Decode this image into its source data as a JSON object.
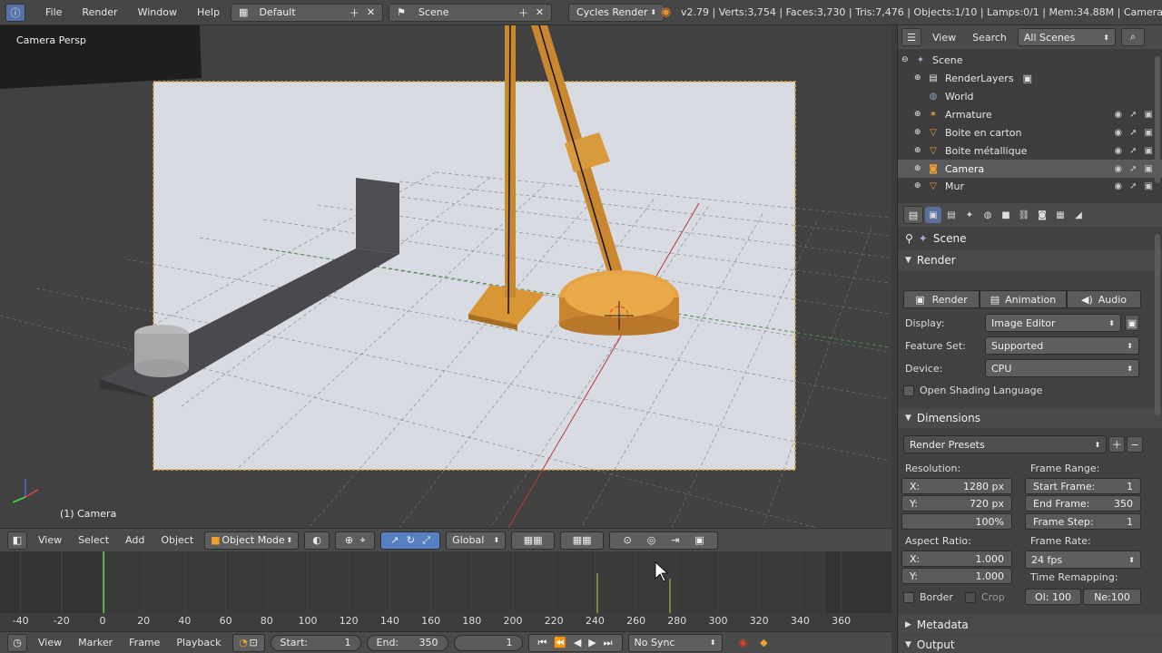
{
  "topbar": {
    "menu": [
      "File",
      "Render",
      "Window",
      "Help"
    ],
    "layout": "Default",
    "scene": "Scene",
    "engine": "Cycles Render",
    "stats": "v2.79 | Verts:3,754 | Faces:3,730 | Tris:7,476 | Objects:1/10 | Lamps:0/1 | Mem:34.88M | Camera"
  },
  "viewport": {
    "label": "Camera Persp",
    "object": "(1) Camera"
  },
  "vp_header": {
    "menu": [
      "View",
      "Select",
      "Add",
      "Object"
    ],
    "mode": "Object Mode",
    "orientation": "Global"
  },
  "timeline": {
    "ticks": [
      -40,
      -20,
      0,
      20,
      40,
      60,
      80,
      100,
      120,
      140,
      160,
      180,
      200,
      220,
      240,
      260,
      280,
      300,
      320,
      340,
      360
    ],
    "current_frame_marker": 1
  },
  "tl_header": {
    "menu": [
      "View",
      "Marker",
      "Frame",
      "Playback"
    ],
    "start_label": "Start:",
    "start_value": "1",
    "end_label": "End:",
    "end_value": "350",
    "current": "1",
    "sync": "No Sync"
  },
  "outliner": {
    "view": "View",
    "search": "Search",
    "filter": "All Scenes",
    "items": [
      "Scene",
      "RenderLayers",
      "World",
      "Armature",
      "Boite en carton",
      "Boite métallique",
      "Camera",
      "Mur"
    ]
  },
  "properties": {
    "context": "Scene",
    "render_title": "Render",
    "render_btn": "Render",
    "animation_btn": "Animation",
    "audio_btn": "Audio",
    "display_label": "Display:",
    "display_value": "Image Editor",
    "feature_label": "Feature Set:",
    "feature_value": "Supported",
    "device_label": "Device:",
    "device_value": "CPU",
    "osl": "Open Shading Language",
    "dimensions_title": "Dimensions",
    "presets": "Render Presets",
    "resolution_label": "Resolution:",
    "res_x_label": "X:",
    "res_x": "1280 px",
    "res_y_label": "Y:",
    "res_y": "720 px",
    "res_pct": "100%",
    "frame_range_label": "Frame Range:",
    "start_frame_label": "Start Frame:",
    "start_frame": "1",
    "end_frame_label": "End Frame:",
    "end_frame": "350",
    "frame_step_label": "Frame Step:",
    "frame_step": "1",
    "aspect_label": "Aspect Ratio:",
    "asp_x_label": "X:",
    "asp_x": "1.000",
    "asp_y_label": "Y:",
    "asp_y": "1.000",
    "frame_rate_label": "Frame Rate:",
    "frame_rate": "24 fps",
    "remap_label": "Time Remapping:",
    "remap_old": "Ol: 100",
    "remap_new": "Ne:100",
    "border": "Border",
    "crop": "Crop",
    "metadata_title": "Metadata",
    "output_title": "Output"
  }
}
